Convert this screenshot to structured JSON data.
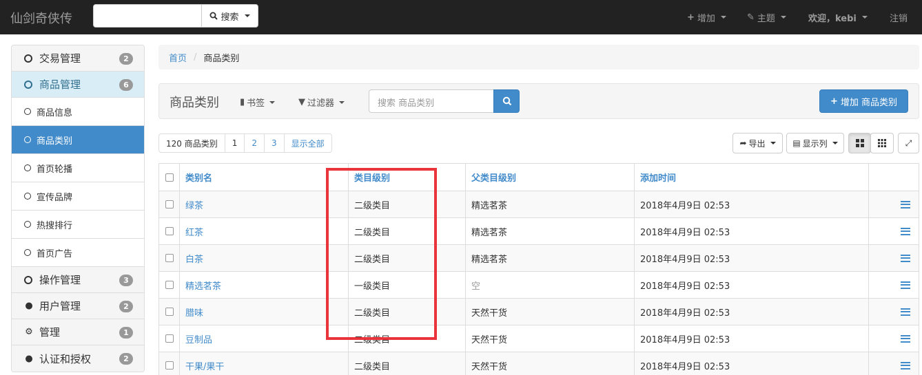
{
  "navbar": {
    "brand": "仙剑奇侠传",
    "search_btn": "搜索",
    "add": "增加",
    "theme": "主题",
    "welcome": "欢迎，kebi",
    "logout": "注销"
  },
  "sidebar": {
    "items": [
      {
        "label": "交易管理",
        "badge": "2"
      },
      {
        "label": "商品管理",
        "badge": "6"
      },
      {
        "label": "商品信息"
      },
      {
        "label": "商品类别"
      },
      {
        "label": "首页轮播"
      },
      {
        "label": "宣传品牌"
      },
      {
        "label": "热搜排行"
      },
      {
        "label": "首页广告"
      },
      {
        "label": "操作管理",
        "badge": "3"
      },
      {
        "label": "用户管理",
        "badge": "2"
      },
      {
        "label": "管理",
        "badge": "1"
      },
      {
        "label": "认证和授权",
        "badge": "2"
      }
    ]
  },
  "breadcrumb": {
    "home": "首页",
    "current": "商品类别"
  },
  "header": {
    "title": "商品类别",
    "bookmarks": "书签",
    "filter": "过滤器",
    "search_placeholder": "搜索 商品类别",
    "add_btn": "增加 商品类别"
  },
  "pager": {
    "count": "120 商品类别",
    "p1": "1",
    "p2": "2",
    "p3": "3",
    "show_all": "显示全部"
  },
  "tools": {
    "export": "导出",
    "columns": "显示列"
  },
  "table": {
    "headers": [
      "类别名",
      "类目级别",
      "父类目级别",
      "添加时间"
    ],
    "rows": [
      [
        "绿茶",
        "二级类目",
        "精选茗茶",
        "2018年4月9日 02:53"
      ],
      [
        "红茶",
        "二级类目",
        "精选茗茶",
        "2018年4月9日 02:53"
      ],
      [
        "白茶",
        "二级类目",
        "精选茗茶",
        "2018年4月9日 02:53"
      ],
      [
        "精选茗茶",
        "一级类目",
        "空",
        "2018年4月9日 02:53"
      ],
      [
        "腊味",
        "二级类目",
        "天然干货",
        "2018年4月9日 02:53"
      ],
      [
        "豆制品",
        "二级类目",
        "天然干货",
        "2018年4月9日 02:53"
      ],
      [
        "干果/果干",
        "二级类目",
        "天然干货",
        "2018年4月9日 02:53"
      ]
    ]
  },
  "colors": {
    "primary": "#428bca",
    "navbar": "#222222",
    "highlight": "#e8343a"
  }
}
